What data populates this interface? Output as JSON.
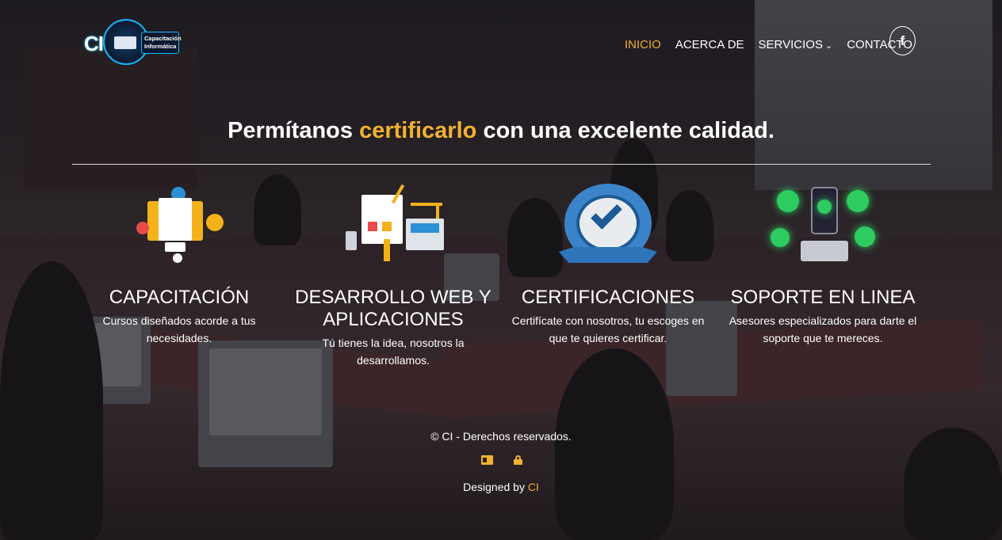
{
  "logo": {
    "mark": "CI",
    "line1": "Capacitación",
    "line2": "Informática"
  },
  "nav": {
    "items": [
      {
        "label": "INICIO",
        "active": true
      },
      {
        "label": "ACERCA DE",
        "active": false
      },
      {
        "label": "SERVICIOS",
        "active": false,
        "dropdown": true
      },
      {
        "label": "CONTACTO",
        "active": false
      }
    ],
    "social_icon": "facebook-icon",
    "social_glyph": "f"
  },
  "hero": {
    "prefix": "Permítanos",
    "highlight": "certificarlo",
    "suffix": "con una excelente calidad."
  },
  "features": [
    {
      "icon": "training-icon",
      "title": "CAPACITACIÓN",
      "description": "Cursos diseñados acorde a tus necesidades."
    },
    {
      "icon": "web-development-icon",
      "title": "DESARROLLO WEB Y APLICACIONES",
      "description": "Tú tienes la idea, nosotros la desarrollamos."
    },
    {
      "icon": "certification-badge-icon",
      "title": "CERTIFICACIONES",
      "description": "Certifícate con nosotros, tu escoges en que te quieres certificar."
    },
    {
      "icon": "online-support-icon",
      "title": "SOPORTE EN LINEA",
      "description": "Asesores especializados para darte el soporte que te mereces."
    }
  ],
  "footer": {
    "copyright": "© CI - Derechos reservados.",
    "icons": [
      "id-card-icon",
      "lock-icon"
    ],
    "designed_prefix": "Designed by",
    "designed_brand": "CI"
  },
  "colors": {
    "accent": "#f2b132",
    "text": "#ffffff"
  }
}
